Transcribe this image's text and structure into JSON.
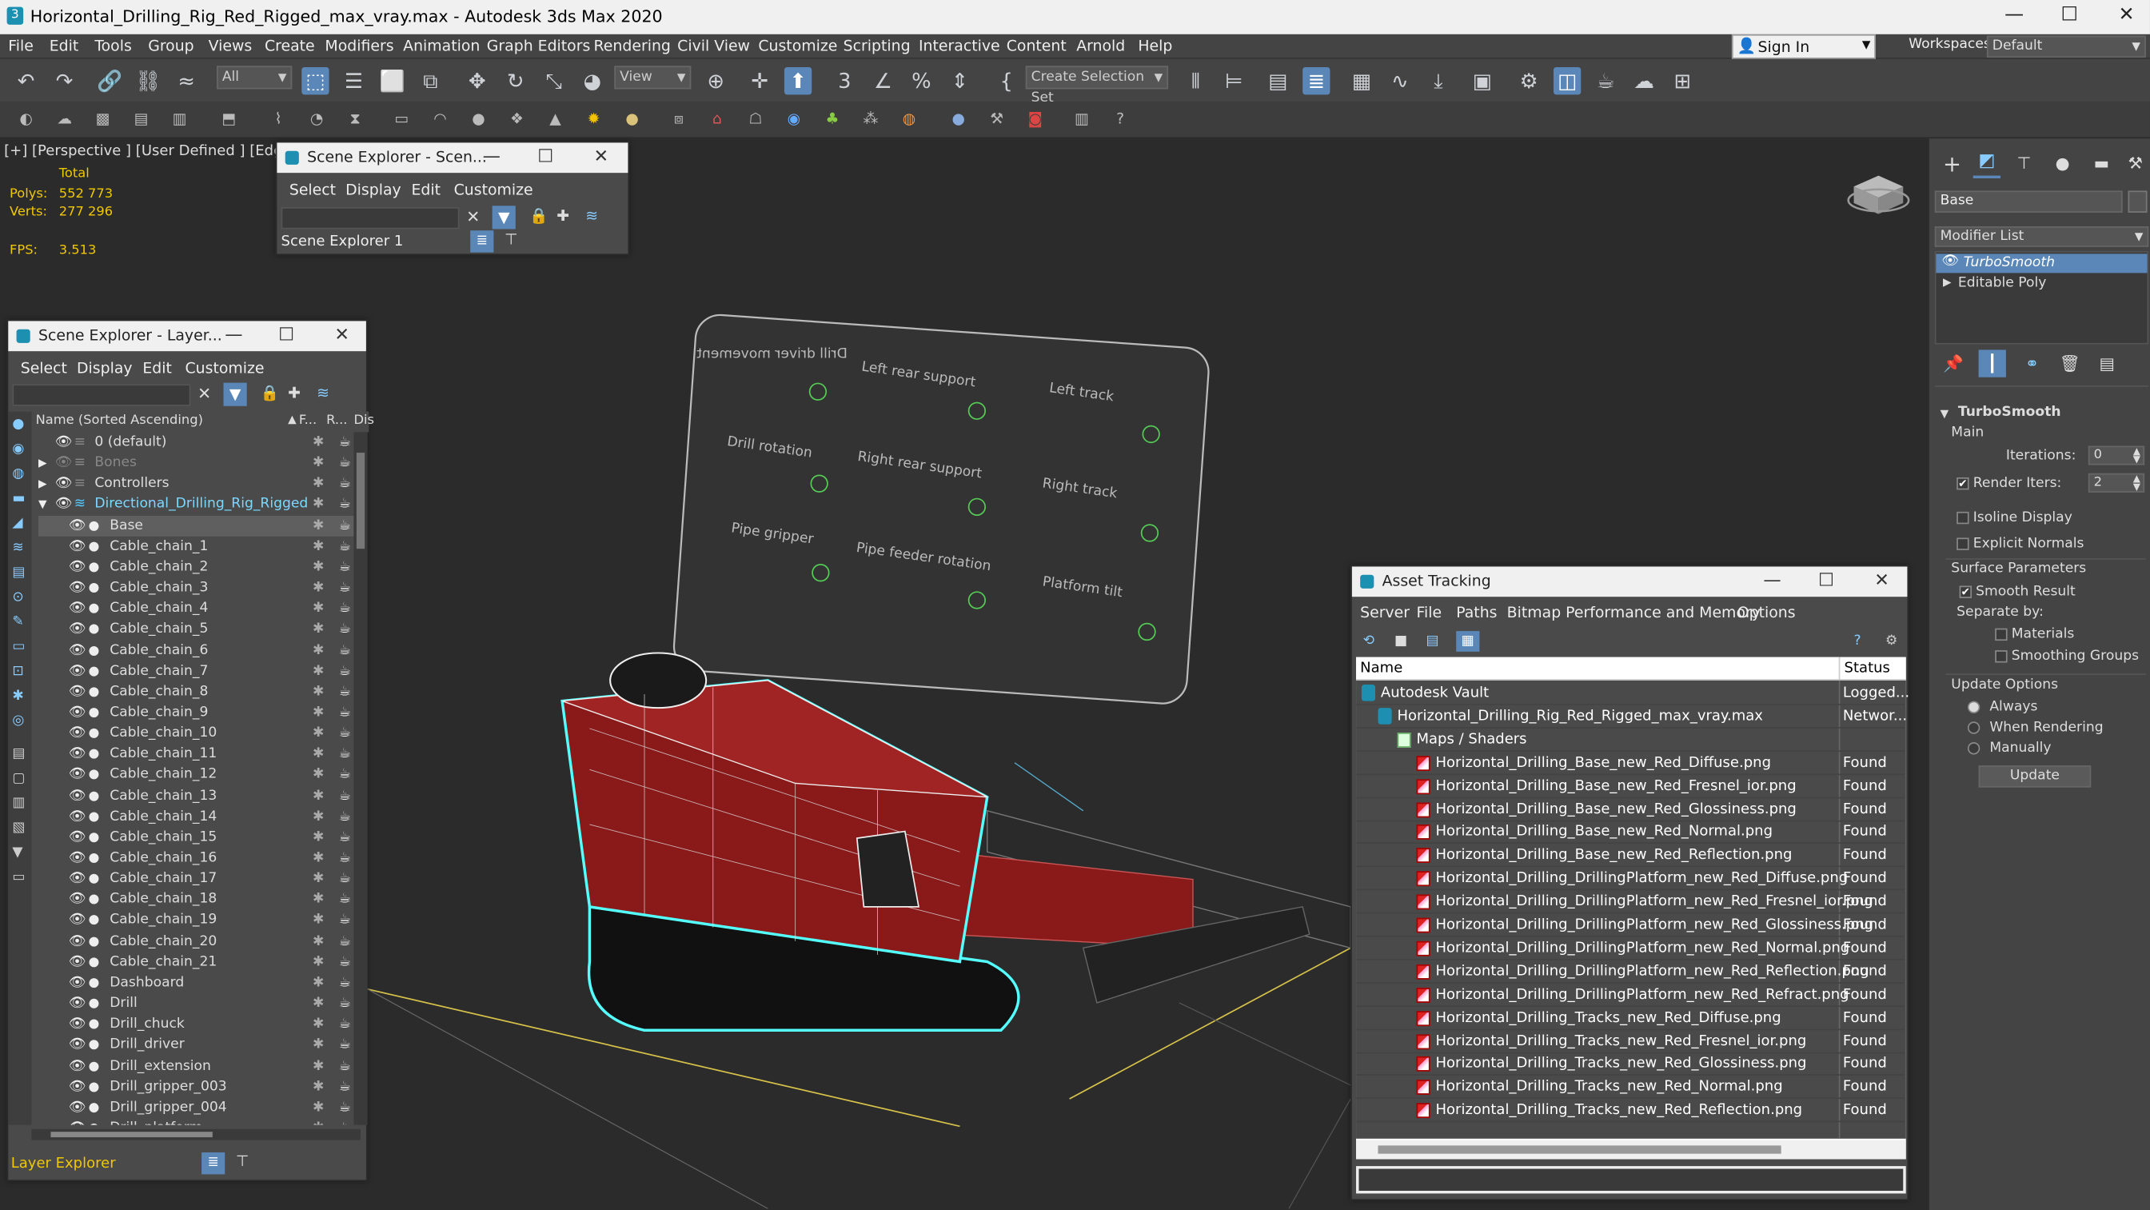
{
  "app": {
    "title": "Horizontal_Drilling_Rig_Red_Rigged_max_vray.max - Autodesk 3ds Max 2020"
  },
  "menu": [
    "File",
    "Edit",
    "Tools",
    "Group",
    "Views",
    "Create",
    "Modifiers",
    "Animation",
    "Graph Editors",
    "Rendering",
    "Civil View",
    "Customize",
    "Scripting",
    "Interactive",
    "Content",
    "Arnold",
    "Help"
  ],
  "account": {
    "sign_in": "Sign In",
    "workspaces_label": "Workspaces:",
    "workspace": "Default"
  },
  "toolbar": {
    "selection_filter": "All",
    "ref_coord": "View",
    "create_selection_set": "Create Selection Set"
  },
  "viewport": {
    "label": "[+] [Perspective ] [User Defined ] [Edged Fac",
    "stats": {
      "total_label": "Total",
      "polys_label": "Polys:",
      "polys": "552 773",
      "verts_label": "Verts:",
      "verts": "277 296",
      "fps_label": "FPS:",
      "fps": "3.513"
    },
    "board_labels": [
      "Drill driver movement",
      "Left rear support",
      "Left track",
      "Drill rotation",
      "Right rear support",
      "Right track",
      "Pipe gripper",
      "Pipe feeder rotation",
      "Platform tilt"
    ]
  },
  "scene_explorer_small": {
    "title": "Scene Explorer - Scen...",
    "menu": [
      "Select",
      "Display",
      "Edit",
      "Customize"
    ],
    "explorer_name": "Scene Explorer 1"
  },
  "layer_explorer": {
    "title": "Scene Explorer - Layer...",
    "menu": [
      "Select",
      "Display",
      "Edit",
      "Customize"
    ],
    "col_name": "Name (Sorted Ascending)",
    "col_f": "F...",
    "col_r": "R...",
    "col_dis": "Dis",
    "rows": [
      {
        "name": "0 (default)",
        "indent": 0
      },
      {
        "name": "Bones",
        "indent": 0
      },
      {
        "name": "Controllers",
        "indent": 0
      },
      {
        "name": "Directional_Drilling_Rig_Rigged",
        "indent": 0
      },
      {
        "name": "Base",
        "indent": 1
      },
      {
        "name": "Cable_chain_1",
        "indent": 1
      },
      {
        "name": "Cable_chain_2",
        "indent": 1
      },
      {
        "name": "Cable_chain_3",
        "indent": 1
      },
      {
        "name": "Cable_chain_4",
        "indent": 1
      },
      {
        "name": "Cable_chain_5",
        "indent": 1
      },
      {
        "name": "Cable_chain_6",
        "indent": 1
      },
      {
        "name": "Cable_chain_7",
        "indent": 1
      },
      {
        "name": "Cable_chain_8",
        "indent": 1
      },
      {
        "name": "Cable_chain_9",
        "indent": 1
      },
      {
        "name": "Cable_chain_10",
        "indent": 1
      },
      {
        "name": "Cable_chain_11",
        "indent": 1
      },
      {
        "name": "Cable_chain_12",
        "indent": 1
      },
      {
        "name": "Cable_chain_13",
        "indent": 1
      },
      {
        "name": "Cable_chain_14",
        "indent": 1
      },
      {
        "name": "Cable_chain_15",
        "indent": 1
      },
      {
        "name": "Cable_chain_16",
        "indent": 1
      },
      {
        "name": "Cable_chain_17",
        "indent": 1
      },
      {
        "name": "Cable_chain_18",
        "indent": 1
      },
      {
        "name": "Cable_chain_19",
        "indent": 1
      },
      {
        "name": "Cable_chain_20",
        "indent": 1
      },
      {
        "name": "Cable_chain_21",
        "indent": 1
      },
      {
        "name": "Dashboard",
        "indent": 1
      },
      {
        "name": "Drill",
        "indent": 1
      },
      {
        "name": "Drill_chuck",
        "indent": 1
      },
      {
        "name": "Drill_driver",
        "indent": 1
      },
      {
        "name": "Drill_extension",
        "indent": 1
      },
      {
        "name": "Drill_gripper_003",
        "indent": 1
      },
      {
        "name": "Drill_gripper_004",
        "indent": 1
      },
      {
        "name": "Drill_platform",
        "indent": 1
      }
    ],
    "footer": "Layer Explorer"
  },
  "asset_tracking": {
    "title": "Asset Tracking",
    "menu": [
      "Server",
      "File",
      "Paths",
      "Bitmap Performance and Memory",
      "Options"
    ],
    "col_name": "Name",
    "col_status": "Status",
    "vault": {
      "name": "Autodesk Vault",
      "status": "Logged..."
    },
    "file": {
      "name": "Horizontal_Drilling_Rig_Red_Rigged_max_vray.max",
      "status": "Networ..."
    },
    "maps_folder": "Maps / Shaders",
    "maps": [
      {
        "name": "Horizontal_Drilling_Base_new_Red_Diffuse.png",
        "status": "Found"
      },
      {
        "name": "Horizontal_Drilling_Base_new_Red_Fresnel_ior.png",
        "status": "Found"
      },
      {
        "name": "Horizontal_Drilling_Base_new_Red_Glossiness.png",
        "status": "Found"
      },
      {
        "name": "Horizontal_Drilling_Base_new_Red_Normal.png",
        "status": "Found"
      },
      {
        "name": "Horizontal_Drilling_Base_new_Red_Reflection.png",
        "status": "Found"
      },
      {
        "name": "Horizontal_Drilling_DrillingPlatform_new_Red_Diffuse.png",
        "status": "Found"
      },
      {
        "name": "Horizontal_Drilling_DrillingPlatform_new_Red_Fresnel_ior.png",
        "status": "Found"
      },
      {
        "name": "Horizontal_Drilling_DrillingPlatform_new_Red_Glossiness.png",
        "status": "Found"
      },
      {
        "name": "Horizontal_Drilling_DrillingPlatform_new_Red_Normal.png",
        "status": "Found"
      },
      {
        "name": "Horizontal_Drilling_DrillingPlatform_new_Red_Reflection.png",
        "status": "Found"
      },
      {
        "name": "Horizontal_Drilling_DrillingPlatform_new_Red_Refract.png",
        "status": "Found"
      },
      {
        "name": "Horizontal_Drilling_Tracks_new_Red_Diffuse.png",
        "status": "Found"
      },
      {
        "name": "Horizontal_Drilling_Tracks_new_Red_Fresnel_ior.png",
        "status": "Found"
      },
      {
        "name": "Horizontal_Drilling_Tracks_new_Red_Glossiness.png",
        "status": "Found"
      },
      {
        "name": "Horizontal_Drilling_Tracks_new_Red_Normal.png",
        "status": "Found"
      },
      {
        "name": "Horizontal_Drilling_Tracks_new_Red_Reflection.png",
        "status": "Found"
      }
    ]
  },
  "command_panel": {
    "object_name": "Base",
    "modifier_list": "Modifier List",
    "stack": [
      "TurboSmooth",
      "Editable Poly"
    ],
    "rollout_title": "TurboSmooth",
    "main_label": "Main",
    "iterations_label": "Iterations:",
    "iterations": "0",
    "render_iters_label": "Render Iters:",
    "render_iters": "2",
    "isoline": "Isoline Display",
    "explicit_normals": "Explicit Normals",
    "surface_params": "Surface Parameters",
    "smooth_result": "Smooth Result",
    "separate_by": "Separate by:",
    "materials": "Materials",
    "smoothing_groups": "Smoothing Groups",
    "update_options": "Update Options",
    "always": "Always",
    "when_rendering": "When Rendering",
    "manually": "Manually",
    "update_button": "Update"
  },
  "colors": {
    "accent": "#5a87b7",
    "selection": "#cde8ff",
    "model_red": "#8a1a1a",
    "wire_cyan": "#5ff"
  }
}
